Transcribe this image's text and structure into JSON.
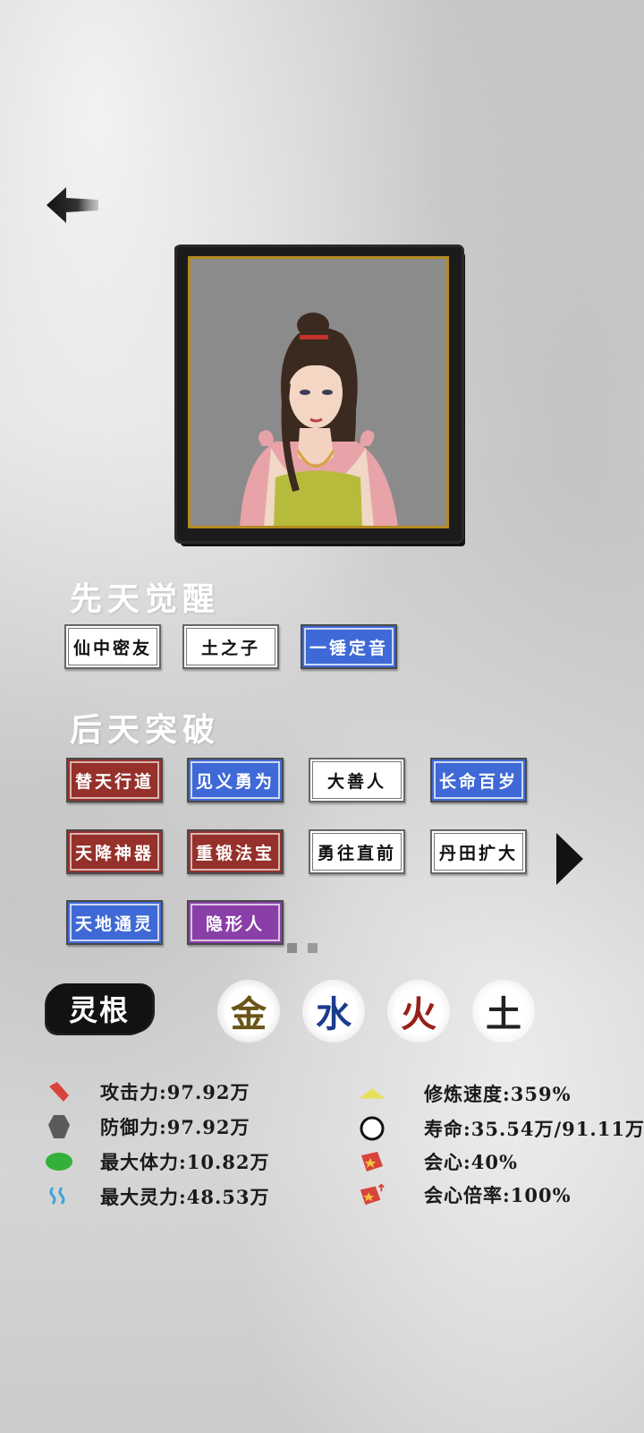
{
  "nav": {
    "back_icon": "back-arrow-icon"
  },
  "portrait": {
    "alt": "character-portrait"
  },
  "innate": {
    "title": "先天觉醒",
    "tags": [
      {
        "label": "仙中密友",
        "color": "white"
      },
      {
        "label": "土之子",
        "color": "white"
      },
      {
        "label": "一锤定音",
        "color": "blue"
      }
    ]
  },
  "acquired": {
    "title": "后天突破",
    "tags": [
      {
        "label": "替天行道",
        "color": "red"
      },
      {
        "label": "见义勇为",
        "color": "blue"
      },
      {
        "label": "大善人",
        "color": "white"
      },
      {
        "label": "长命百岁",
        "color": "blue"
      },
      {
        "label": "天降神器",
        "color": "red"
      },
      {
        "label": "重锻法宝",
        "color": "red"
      },
      {
        "label": "勇往直前",
        "color": "white"
      },
      {
        "label": "丹田扩大",
        "color": "white"
      },
      {
        "label": "天地通灵",
        "color": "blue"
      },
      {
        "label": "隐形人",
        "color": "purple"
      }
    ],
    "page_indicator": {
      "current": 1,
      "total": 2
    }
  },
  "spirit_root": {
    "label": "灵根",
    "elements": [
      "金",
      "水",
      "火",
      "土"
    ]
  },
  "stats": {
    "attack": "攻击力:97.92万",
    "defense": "防御力:97.92万",
    "max_hp": "最大体力:10.82万",
    "max_mana": "最大灵力:48.53万",
    "cultivation_speed": "修炼速度:359%",
    "lifespan": "寿命:35.54万/91.11万",
    "crit": "会心:40%",
    "crit_multiplier": "会心倍率:100%"
  },
  "colors": {
    "tag_white": "#ffffff",
    "tag_blue": "#3f69d6",
    "tag_red": "#96302b",
    "tag_purple": "#8a3fa8",
    "frame_gold": "#b38b1f"
  }
}
